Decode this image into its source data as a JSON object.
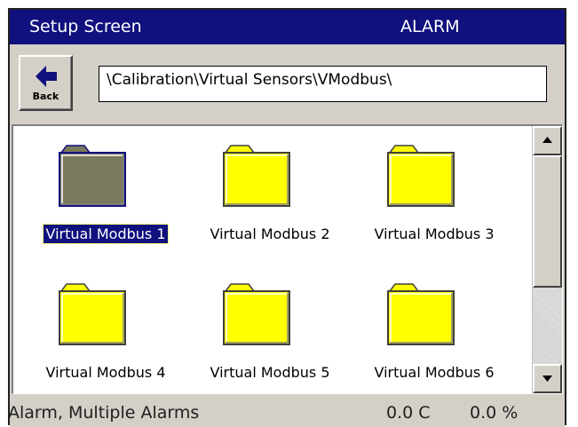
{
  "header": {
    "title": "Setup Screen",
    "alarm_label": "ALARM"
  },
  "toolbar": {
    "back_label": "Back",
    "path": "\\Calibration\\Virtual Sensors\\VModbus\\"
  },
  "browser": {
    "items": [
      {
        "label": "Virtual Modbus 1",
        "selected": true,
        "icon": "folder-icon"
      },
      {
        "label": "Virtual Modbus 2",
        "selected": false,
        "icon": "folder-icon"
      },
      {
        "label": "Virtual Modbus 3",
        "selected": false,
        "icon": "folder-icon"
      },
      {
        "label": "Virtual Modbus 4",
        "selected": false,
        "icon": "folder-icon"
      },
      {
        "label": "Virtual Modbus 5",
        "selected": false,
        "icon": "folder-icon"
      },
      {
        "label": "Virtual Modbus 6",
        "selected": false,
        "icon": "folder-icon"
      }
    ]
  },
  "status": {
    "message": "Alarm, Multiple Alarms",
    "temperature": "0.0 C",
    "percent": "0.0 %"
  },
  "colors": {
    "titlebar": "#10107e",
    "folder": "#ffff00",
    "selected_folder": "#7a7a5c"
  }
}
